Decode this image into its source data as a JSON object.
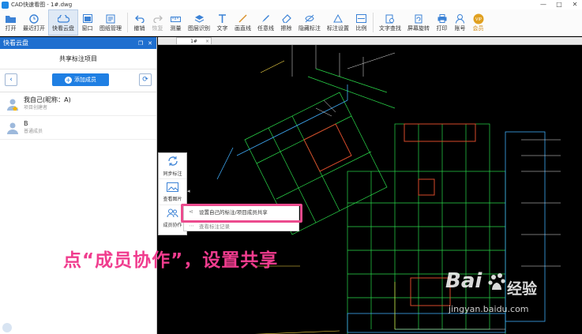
{
  "window": {
    "title": "CAD快速看图 - 1#.dwg",
    "controls": [
      "—",
      "□",
      "✕"
    ]
  },
  "toolbar": {
    "items": [
      {
        "label": "打开",
        "icon": "folder-icon"
      },
      {
        "label": "最近打开",
        "icon": "clock-icon"
      },
      {
        "label": "快看云盘",
        "icon": "cloud-icon"
      },
      {
        "label": "窗口",
        "icon": "window-icon"
      },
      {
        "label": "图纸管理",
        "icon": "drawing-manage-icon"
      },
      {
        "label": "撤销",
        "icon": "undo-icon"
      },
      {
        "label": "恢复",
        "icon": "redo-icon"
      },
      {
        "label": "测量",
        "icon": "measure-icon"
      },
      {
        "label": "图层识别",
        "icon": "layer-icon"
      },
      {
        "label": "文字",
        "icon": "text-icon"
      },
      {
        "label": "画直线",
        "icon": "line-icon"
      },
      {
        "label": "任意线",
        "icon": "freehand-icon"
      },
      {
        "label": "擦除",
        "icon": "eraser-icon"
      },
      {
        "label": "隐藏标注",
        "icon": "hide-annotation-icon"
      },
      {
        "label": "标注设置",
        "icon": "annotation-settings-icon"
      },
      {
        "label": "比例",
        "icon": "scale-icon"
      },
      {
        "label": "文字查找",
        "icon": "text-search-icon"
      },
      {
        "label": "屏幕旋转",
        "icon": "rotate-icon"
      },
      {
        "label": "打印",
        "icon": "print-icon"
      },
      {
        "label": "账号",
        "icon": "account-icon"
      },
      {
        "label": "会员",
        "icon": "vip-icon"
      }
    ]
  },
  "panel": {
    "header": "快看云盘",
    "subtitle": "共享标注项目",
    "add_button": "添加成员",
    "members": [
      {
        "name": "我自己(昵称：A)",
        "role": "项目创建者"
      },
      {
        "name": "B",
        "role": "普通成员"
      }
    ]
  },
  "document": {
    "tab": "1#"
  },
  "mini_toolbar": {
    "items": [
      {
        "label": "同步标注",
        "icon": "sync-icon"
      },
      {
        "label": "查看图片",
        "icon": "image-icon"
      },
      {
        "label": "成员协作",
        "icon": "members-icon"
      }
    ]
  },
  "popup": {
    "items": [
      {
        "label": "设置自己的标注/项目成员共享",
        "icon": "share-icon"
      },
      {
        "label": "查看标注记录",
        "icon": "record-icon"
      }
    ]
  },
  "annotation_text": "点“成员协作”，设置共享",
  "watermark": {
    "logo": "Bai",
    "brand": "经验",
    "url": "jingyan.baidu.com"
  },
  "colors": {
    "accent_blue": "#1f6fcf",
    "highlight_pink": "#ec4b8e",
    "canvas_bg": "#000000"
  }
}
